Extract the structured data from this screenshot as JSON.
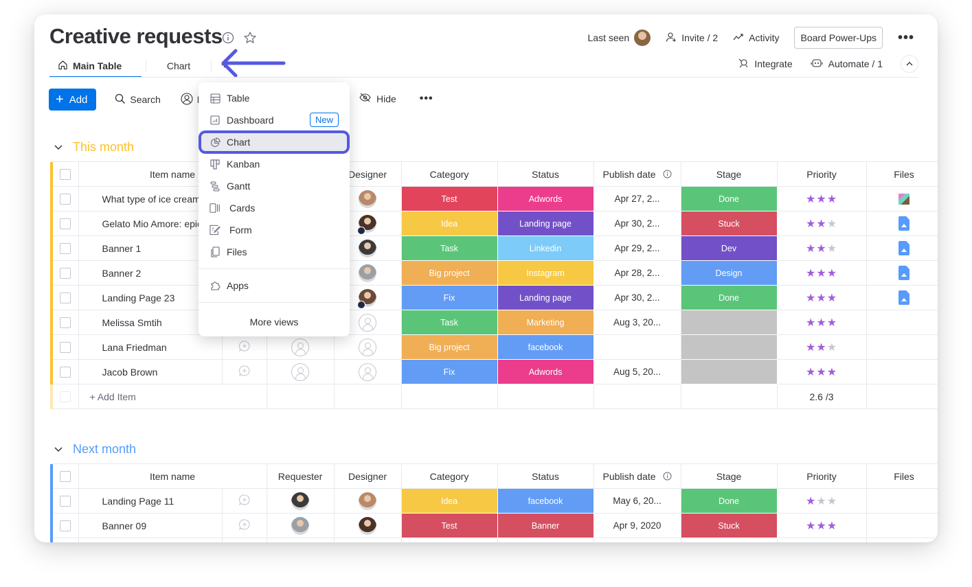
{
  "header": {
    "title": "Creative requests",
    "last_seen_label": "Last seen",
    "invite_label": "Invite / 2",
    "activity_label": "Activity",
    "power_ups_label": "Board Power-Ups",
    "integrate_label": "Integrate",
    "automate_label": "Automate / 1"
  },
  "tabs": [
    {
      "label": "Main Table",
      "icon": "home-icon",
      "active": true
    },
    {
      "label": "Chart",
      "active": false
    },
    {
      "label": "+",
      "icon": "plus-icon"
    }
  ],
  "toolbar": {
    "add_label": "Add",
    "search_label": "Search",
    "person_label": "Pe",
    "hide_label": "Hide"
  },
  "dropdown": {
    "items": [
      {
        "label": "Table",
        "icon": "table-icon"
      },
      {
        "label": "Dashboard",
        "icon": "dashboard-icon",
        "badge": "New"
      },
      {
        "label": "Chart",
        "icon": "pie-chart-icon",
        "highlighted": true
      },
      {
        "label": "Kanban",
        "icon": "kanban-icon"
      },
      {
        "label": "Gantt",
        "icon": "gantt-icon"
      },
      {
        "label": "Cards",
        "icon": "cards-icon"
      },
      {
        "label": "Form",
        "icon": "form-icon"
      },
      {
        "label": "Files",
        "icon": "files-icon"
      }
    ],
    "apps_label": "Apps",
    "more_label": "More views"
  },
  "colors": {
    "primary": "#0073ea",
    "highlight_ring": "#5559df",
    "this_month_group": "#fdc02f",
    "next_month_group": "#579bfc",
    "star_on": "#a25ddc"
  },
  "columns": [
    "Item name",
    "Requester",
    "Designer",
    "Category",
    "Status",
    "Publish date",
    "Stage",
    "Priority",
    "Files"
  ],
  "groups": [
    {
      "title": "This month",
      "color": "#fdc02f",
      "rows": [
        {
          "name": "What type of ice cream",
          "designer": "photo",
          "category": "Test",
          "category_color": "#e2445c",
          "status": "Adwords",
          "status_color": "#ec3c8c",
          "date": "Apr 27, 2...",
          "stage": "Done",
          "stage_color": "#5ac579",
          "priority": 3,
          "file": "thumbnail"
        },
        {
          "name": "Gelato Mio Amore: epic",
          "designer": "photo-home",
          "category": "Idea",
          "category_color": "#f7c843",
          "status": "Landing page",
          "status_color": "#7251c8",
          "date": "Apr 30, 2...",
          "stage": "Stuck",
          "stage_color": "#d54f61",
          "priority": 2,
          "file": "image"
        },
        {
          "name": "Banner 1",
          "designer": "photo",
          "category": "Task",
          "category_color": "#5ac579",
          "status": "Linkedin",
          "status_color": "#7ccbf9",
          "date": "Apr 29, 2...",
          "stage": "Dev",
          "stage_color": "#7251c8",
          "priority": 2,
          "file": "image"
        },
        {
          "name": "Banner 2",
          "designer": "photo",
          "category": "Big project",
          "category_color": "#f0ae55",
          "status": "Instagram",
          "status_color": "#f7c843",
          "date": "Apr 28, 2...",
          "stage": "Design",
          "stage_color": "#629cf5",
          "priority": 3,
          "file": "image"
        },
        {
          "name": "Landing Page 23",
          "designer": "photo-home",
          "category": "Fix",
          "category_color": "#629cf5",
          "status": "Landing page",
          "status_color": "#7251c8",
          "date": "Apr 30, 2...",
          "stage": "Done",
          "stage_color": "#5ac579",
          "priority": 3,
          "file": "image"
        },
        {
          "name": "Melissa Smtih",
          "designer": "empty",
          "category": "Task",
          "category_color": "#5ac579",
          "status": "Marketing",
          "status_color": "#f0ae55",
          "date": "Aug 3, 20...",
          "stage": "",
          "stage_color": "#c4c4c4",
          "priority": 3,
          "file": ""
        },
        {
          "name": "Lana Friedman",
          "requester": "empty",
          "designer": "empty",
          "category": "Big project",
          "category_color": "#f0ae55",
          "status": "facebook",
          "status_color": "#629cf5",
          "date": "",
          "stage": "",
          "stage_color": "#c4c4c4",
          "priority": 2,
          "file": ""
        },
        {
          "name": "Jacob Brown",
          "requester": "empty",
          "designer": "empty",
          "category": "Fix",
          "category_color": "#629cf5",
          "status": "Adwords",
          "status_color": "#ec3c8c",
          "date": "Aug 5, 20...",
          "stage": "",
          "stage_color": "#c4c4c4",
          "priority": 3,
          "file": ""
        }
      ],
      "add_item_label": "+ Add Item",
      "priority_summary": "2.6 /3"
    },
    {
      "title": "Next month",
      "color": "#579bfc",
      "rows": [
        {
          "name": "Landing Page 11",
          "requester": "photo",
          "designer": "photo",
          "category": "Idea",
          "category_color": "#f7c843",
          "status": "facebook",
          "status_color": "#629cf5",
          "date": "May 6, 20...",
          "stage": "Done",
          "stage_color": "#5ac579",
          "priority": 1,
          "file": ""
        },
        {
          "name": "Banner 09",
          "requester": "photo",
          "designer": "photo",
          "category": "Test",
          "category_color": "#d54f61",
          "status": "Banner",
          "status_color": "#d54f61",
          "date": "Apr 9, 2020",
          "stage": "Stuck",
          "stage_color": "#d54f61",
          "priority": 3,
          "file": ""
        }
      ]
    }
  ]
}
